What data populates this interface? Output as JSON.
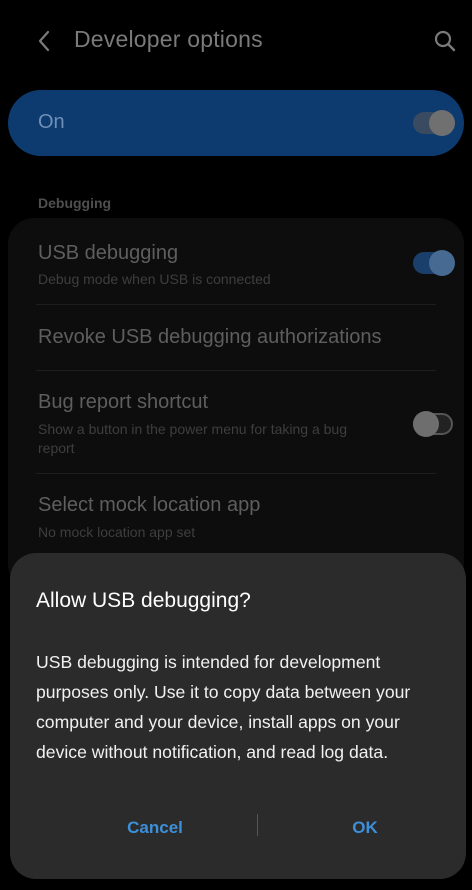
{
  "appbar": {
    "title": "Developer options",
    "back_icon": "chevron-left-icon",
    "search_icon": "search-icon"
  },
  "master": {
    "label": "On",
    "enabled": true
  },
  "section": {
    "debugging": "Debugging"
  },
  "settings": {
    "usb_debugging": {
      "title": "USB debugging",
      "summary": "Debug mode when USB is connected",
      "enabled": true
    },
    "revoke": {
      "title": "Revoke USB debugging authorizations"
    },
    "bug_report": {
      "title": "Bug report shortcut",
      "summary": "Show a button in the power menu for taking a bug report",
      "enabled": false
    },
    "mock_location": {
      "title": "Select mock location app",
      "summary": "No mock location app set"
    }
  },
  "dialog": {
    "title": "Allow USB debugging?",
    "body": "USB debugging is intended for development purposes only. Use it to copy data between your computer and your device, install apps on your device without notification, and read log data.",
    "cancel": "Cancel",
    "ok": "OK"
  },
  "colors": {
    "accent": "#3d8fd8",
    "dialog_bg": "#2b2b2b",
    "master_bg": "#0d3b70"
  }
}
